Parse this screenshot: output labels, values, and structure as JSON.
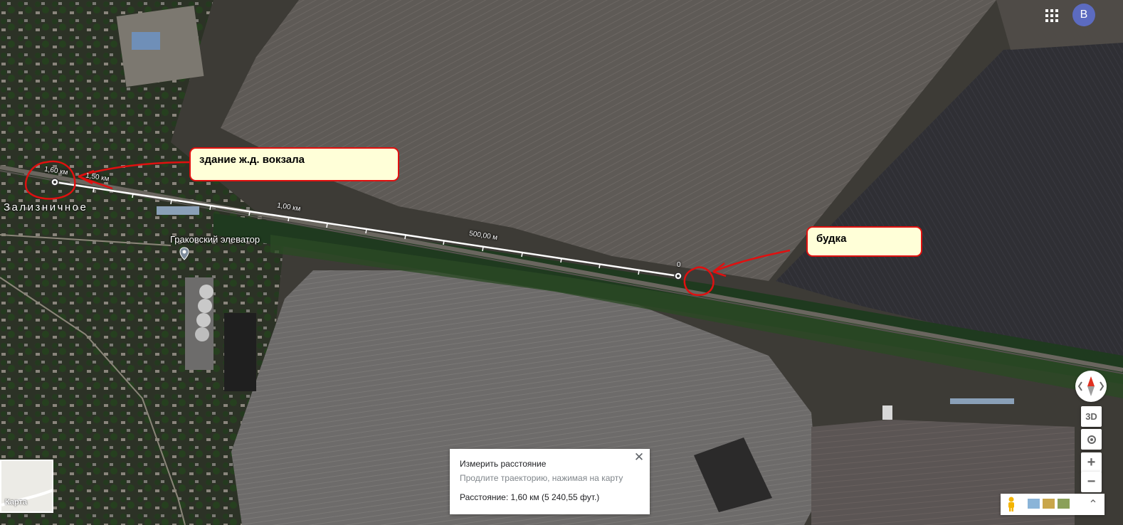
{
  "header": {
    "account_initial": "B",
    "apps_icon": "apps-grid-icon"
  },
  "map": {
    "place_label": "Зализничное",
    "poi_label": "Граковский элеватор",
    "scale_labels": [
      "1,60 км",
      "1,50 км",
      "1,00 км",
      "500,00 м",
      "0"
    ]
  },
  "callouts": {
    "station": "здание ж.д. вокзала",
    "booth": "будка"
  },
  "measure": {
    "title": "Измерить расстояние",
    "hint": "Продлите траекторию, нажимая на карту",
    "distance": "Расстояние: 1,60 км (5 240,55 фут.)"
  },
  "controls": {
    "compass": "compass-icon",
    "tilt_label": "3D",
    "zoom_in": "+",
    "zoom_out": "−",
    "expand": "⌃"
  },
  "layer_toggle": {
    "label": "Карта"
  },
  "colors": {
    "annotation_red": "#e01010",
    "callout_bg": "#ffffd8",
    "avatar_bg": "#5c6bc0"
  }
}
